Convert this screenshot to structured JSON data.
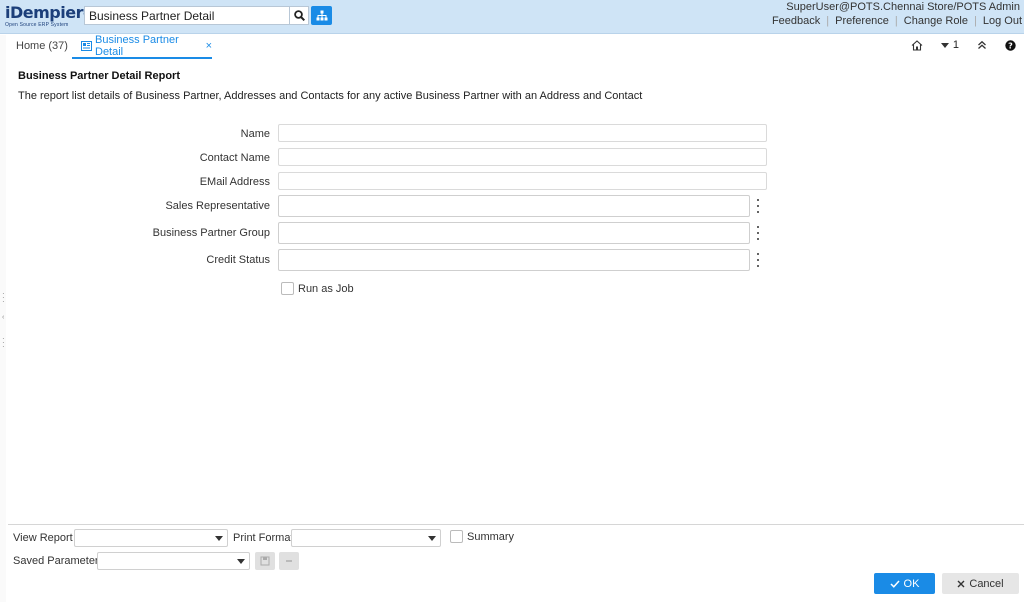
{
  "header": {
    "logo_text": "iDempiere",
    "logo_subtext": "Open Source ERP System",
    "search_value": "Business Partner Detail",
    "user_context": "SuperUser@POTS.Chennai Store/POTS Admin",
    "links": [
      "Feedback",
      "Preference",
      "Change Role",
      "Log Out"
    ]
  },
  "tabs": {
    "home_label": "Home (37)",
    "active_label": "Business Partner Detail",
    "close_glyph": "×",
    "window_count": "1"
  },
  "report": {
    "title": "Business Partner Detail Report",
    "description": "The report list details of Business Partner, Addresses and Contacts for any active Business Partner with an Address and Contact"
  },
  "form": {
    "fields": [
      {
        "label": "Name",
        "value": ""
      },
      {
        "label": "Contact Name",
        "value": ""
      },
      {
        "label": "EMail Address",
        "value": ""
      },
      {
        "label": "Sales Representative",
        "value": ""
      },
      {
        "label": "Business Partner Group",
        "value": ""
      },
      {
        "label": "Credit Status",
        "value": ""
      }
    ],
    "run_as_job_label": "Run as Job"
  },
  "footer": {
    "view_report_label": "View Report",
    "print_format_label": "Print Format",
    "summary_label": "Summary",
    "saved_parameters_label": "Saved Parameters",
    "ok_label": "OK",
    "cancel_label": "Cancel"
  },
  "colors": {
    "header_bg": "#cfe4f6",
    "accent": "#1a8be6"
  }
}
